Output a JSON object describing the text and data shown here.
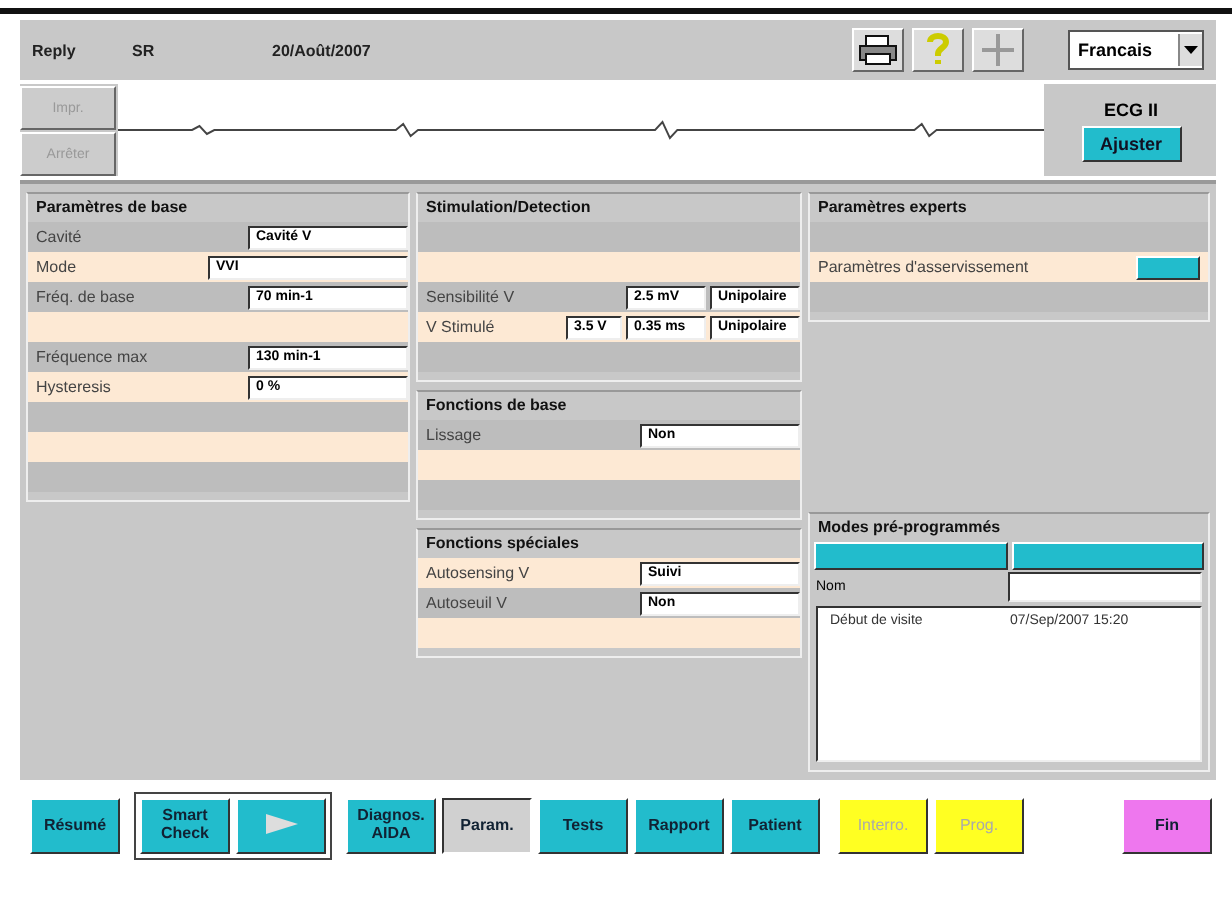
{
  "header": {
    "product": "Reply",
    "mode": "SR",
    "date": "20/Août/2007",
    "language": "Francais"
  },
  "side_buttons": [
    {
      "label": "Impr.",
      "disabled": true
    },
    {
      "label": "Arrêter",
      "disabled": true
    }
  ],
  "ecg": {
    "lead": "ECG II",
    "adjust_button": "Ajuster"
  },
  "columns": [
    [
      {
        "title": "Paramètres de base",
        "rows": [
          {
            "kind": "field",
            "highlight": false,
            "label": "Cavité",
            "values": [
              "Cavité V"
            ]
          },
          {
            "kind": "wide",
            "highlight": true,
            "label": "Mode",
            "values": [
              "VVI"
            ]
          },
          {
            "kind": "field",
            "highlight": false,
            "label": "Fréq. de base",
            "values": [
              "70 min-1"
            ]
          },
          {
            "kind": "blank",
            "highlight": true
          },
          {
            "kind": "field",
            "highlight": false,
            "label": "Fréquence max",
            "values": [
              "130 min-1"
            ]
          },
          {
            "kind": "field",
            "highlight": true,
            "label": "Hysteresis",
            "values": [
              "0 %"
            ]
          },
          {
            "kind": "blank",
            "highlight": false
          },
          {
            "kind": "blank",
            "highlight": true
          },
          {
            "kind": "blank",
            "highlight": false
          }
        ]
      }
    ],
    [
      {
        "title": "Stimulation/Detection",
        "rows": [
          {
            "kind": "blank",
            "highlight": false
          },
          {
            "kind": "blank",
            "highlight": true
          },
          {
            "kind": "field",
            "highlight": false,
            "label": "Sensibilité V",
            "values": [
              "2.5 mV",
              "Unipolaire"
            ]
          },
          {
            "kind": "field",
            "highlight": true,
            "label": "V Stimulé",
            "values": [
              "3.5 V",
              "0.35 ms",
              "Unipolaire"
            ]
          },
          {
            "kind": "blank",
            "highlight": false
          }
        ]
      },
      {
        "title": "Fonctions de base",
        "rows": [
          {
            "kind": "field",
            "highlight": false,
            "label": "Lissage",
            "values": [
              "Non"
            ]
          },
          {
            "kind": "blank",
            "highlight": true
          },
          {
            "kind": "blank",
            "highlight": false
          }
        ]
      },
      {
        "title": "Fonctions spéciales",
        "rows": [
          {
            "kind": "field",
            "highlight": true,
            "label": "Autosensing V",
            "values": [
              "Suivi"
            ]
          },
          {
            "kind": "field",
            "highlight": false,
            "label": "Autoseuil V",
            "values": [
              "Non"
            ]
          },
          {
            "kind": "blank",
            "highlight": true
          }
        ]
      }
    ],
    [
      {
        "title": "Paramètres experts",
        "rows": [
          {
            "kind": "blank",
            "highlight": false
          },
          {
            "kind": "more",
            "highlight": true,
            "label": "Paramètres d'asservissement"
          },
          {
            "kind": "blank",
            "highlight": false
          }
        ]
      }
    ]
  ],
  "presets": {
    "title": "Modes pré-programmés",
    "name_label": "Nom",
    "entries": [
      {
        "name": "Début de visite",
        "time": "07/Sep/2007 15:20"
      }
    ]
  },
  "nav_groups": [
    {
      "framed": false,
      "buttons": [
        {
          "label": "Résumé",
          "color": "#22bccc",
          "selected": false,
          "disabled": false
        }
      ]
    },
    {
      "framed": true,
      "buttons": [
        {
          "label": "Smart Check",
          "color": "#22bccc",
          "selected": false,
          "disabled": false
        },
        {
          "kind": "play",
          "color": "#22bccc",
          "selected": false,
          "disabled": false
        }
      ]
    },
    {
      "framed": false,
      "buttons": [
        {
          "label": "Diagnos. AIDA",
          "color": "#22bccc",
          "selected": false,
          "disabled": false
        },
        {
          "label": "Param.",
          "color": "#d0d0d0",
          "selected": true,
          "disabled": false
        },
        {
          "label": "Tests",
          "color": "#22bccc",
          "selected": false,
          "disabled": false
        },
        {
          "label": "Rapport",
          "color": "#22bccc",
          "selected": false,
          "disabled": false
        },
        {
          "label": "Patient",
          "color": "#22bccc",
          "selected": false,
          "disabled": false
        }
      ]
    },
    {
      "framed": false,
      "buttons": [
        {
          "label": "Interro.",
          "color": "#ffff22",
          "selected": false,
          "disabled": true
        },
        {
          "label": "Prog.",
          "color": "#ffff22",
          "selected": false,
          "disabled": true
        }
      ]
    },
    {
      "framed": false,
      "buttons": [
        {
          "label": "Fin",
          "color": "#ee77ee",
          "selected": false,
          "disabled": false
        }
      ]
    }
  ]
}
